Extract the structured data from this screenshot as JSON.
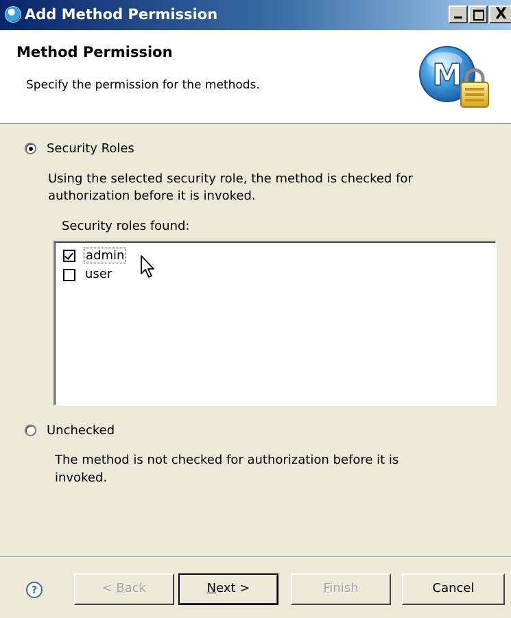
{
  "window": {
    "title": "Add Method Permission",
    "close_glyph": "X"
  },
  "header": {
    "title": "Method Permission",
    "description": "Specify the permission for the methods.",
    "badge_icon": "method-lock-icon",
    "badge_letter": "M"
  },
  "options": {
    "security_roles": {
      "label": "Security Roles",
      "selected": true,
      "description": "Using the selected security role, the method is checked for authorization before it is invoked.",
      "found_label": "Security roles found:",
      "roles": [
        {
          "label": "admin",
          "checked": true
        },
        {
          "label": "user",
          "checked": false
        }
      ]
    },
    "unchecked": {
      "label": "Unchecked",
      "selected": false,
      "description": "The method is not checked for authorization before it is invoked."
    }
  },
  "footer": {
    "help_glyph": "?",
    "back": {
      "prefix": "< ",
      "mnemonic": "B",
      "rest": "ack",
      "enabled": false
    },
    "next": {
      "mnemonic": "N",
      "rest": "ext >",
      "enabled": true
    },
    "finish": {
      "mnemonic": "F",
      "rest": "inish",
      "enabled": false
    },
    "cancel": {
      "label": "Cancel",
      "enabled": true
    }
  },
  "colors": {
    "title_bar_start": "#0a246a",
    "title_bar_end": "#a6caf0",
    "dialog_bg": "#ece9d8"
  }
}
